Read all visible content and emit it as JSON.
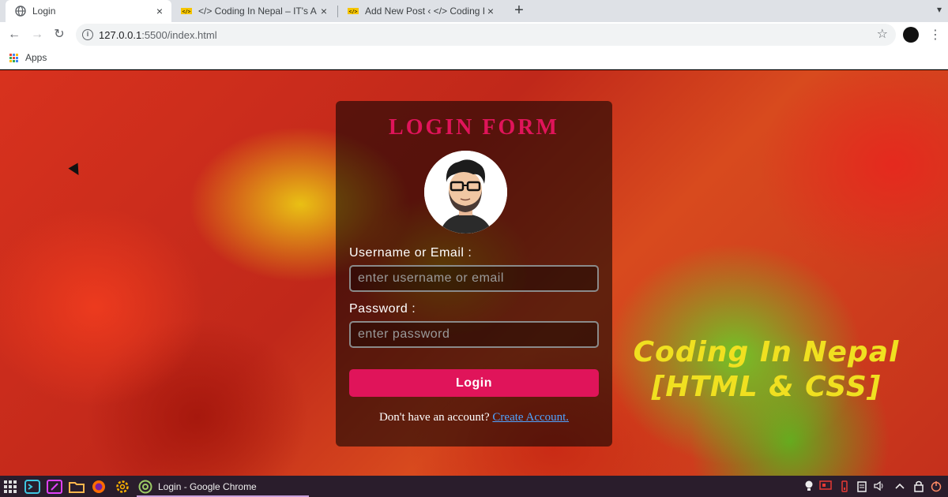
{
  "browser": {
    "tabs": [
      {
        "title": "Login",
        "active": true
      },
      {
        "title": "</> Coding In Nepal – IT's ALL",
        "active": false
      },
      {
        "title": "Add New Post ‹ </> Coding In",
        "active": false
      }
    ],
    "new_tab": "+",
    "url_host": "127.0.0.1",
    "url_path": ":5500/index.html",
    "bookmarks": {
      "apps_label": "Apps"
    }
  },
  "page": {
    "form_title": "LOGIN FORM",
    "username_label": "Username or Email :",
    "username_placeholder": "enter username or email",
    "password_label": "Password :",
    "password_placeholder": "enter password",
    "login_button": "Login",
    "signup_prompt": "Don't have an account?",
    "signup_link": "Create Account.",
    "promo_line1": "Coding In Nepal",
    "promo_line2": "[HTML & CSS]",
    "colors": {
      "accent": "#e0145a",
      "promo": "#f0e020",
      "link": "#4fa3ff"
    }
  },
  "taskbar": {
    "active_window": "Login - Google Chrome"
  },
  "icons": [
    "globe-icon",
    "close-icon",
    "back-icon",
    "forward-icon",
    "reload-icon",
    "info-icon",
    "star-icon",
    "profile-icon",
    "menu-icon",
    "apps-grid-icon",
    "avatar-image",
    "app-launcher-icon",
    "terminal-icon",
    "editor-icon",
    "folder-icon",
    "firefox-icon",
    "settings-icon",
    "chrome-icon"
  ]
}
